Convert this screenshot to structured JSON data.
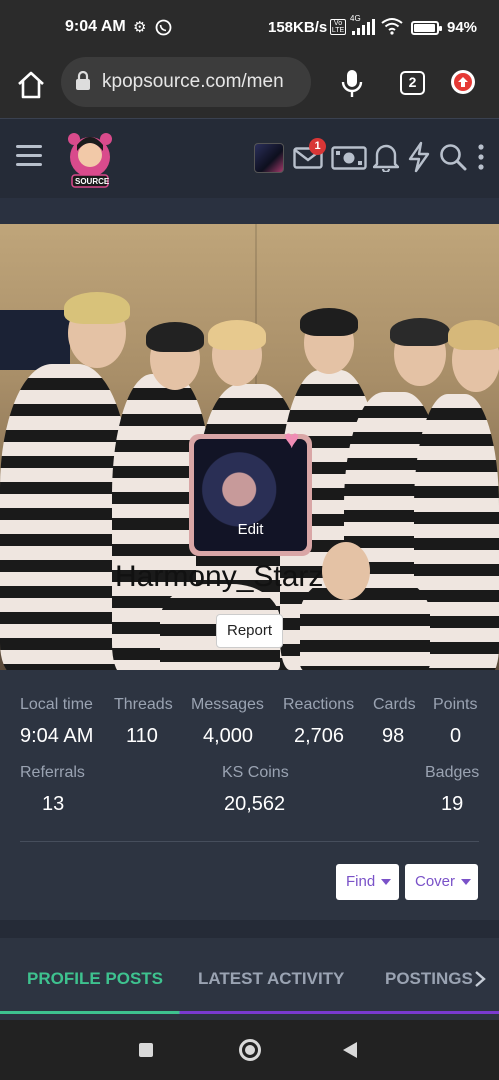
{
  "status_bar": {
    "time": "9:04 AM",
    "net_speed": "158KB/s",
    "volte": "Vo LTE",
    "network": "4G",
    "battery": "94%",
    "battery_level": 0.94,
    "icons": [
      "gear-icon",
      "whatsapp-icon",
      "signal-icon",
      "wifi-icon",
      "battery-icon"
    ]
  },
  "browser": {
    "url": "kpopsource.com/men",
    "tab_count": "2",
    "icons": [
      "home-icon",
      "lock-icon",
      "mic-icon",
      "tabs-icon",
      "update-icon"
    ]
  },
  "site_header": {
    "logo_text": "SOURCE",
    "notification_count": "1",
    "icons": [
      "hamburger-icon",
      "mail-icon",
      "money-icon",
      "bell-icon",
      "bolt-icon",
      "search-icon",
      "more-vertical-icon"
    ]
  },
  "profile": {
    "avatar_action": "Edit",
    "username": "Harmony_Starz",
    "report_label": "Report"
  },
  "stats": {
    "row1": [
      {
        "label": "Local time",
        "value": "9:04 AM"
      },
      {
        "label": "Threads",
        "value": "110"
      },
      {
        "label": "Messages",
        "value": "4,000"
      },
      {
        "label": "Reactions",
        "value": "2,706"
      },
      {
        "label": "Cards",
        "value": "98"
      },
      {
        "label": "Points",
        "value": "0"
      }
    ],
    "row2": [
      {
        "label": "Referrals",
        "value": "13"
      },
      {
        "label": "KS Coins",
        "value": "20,562"
      },
      {
        "label": "Badges",
        "value": "19"
      }
    ]
  },
  "actions": {
    "find_label": "Find",
    "cover_label": "Cover"
  },
  "tabs": [
    {
      "label": "PROFILE POSTS",
      "active": true
    },
    {
      "label": "LATEST ACTIVITY",
      "active": false
    },
    {
      "label": "POSTINGS",
      "active": false
    }
  ],
  "colors": {
    "accent_active_tab": "#3ec28f",
    "accent_purple": "#7a52c8",
    "page_bg": "#2a3140",
    "badge_red": "#d93636"
  }
}
